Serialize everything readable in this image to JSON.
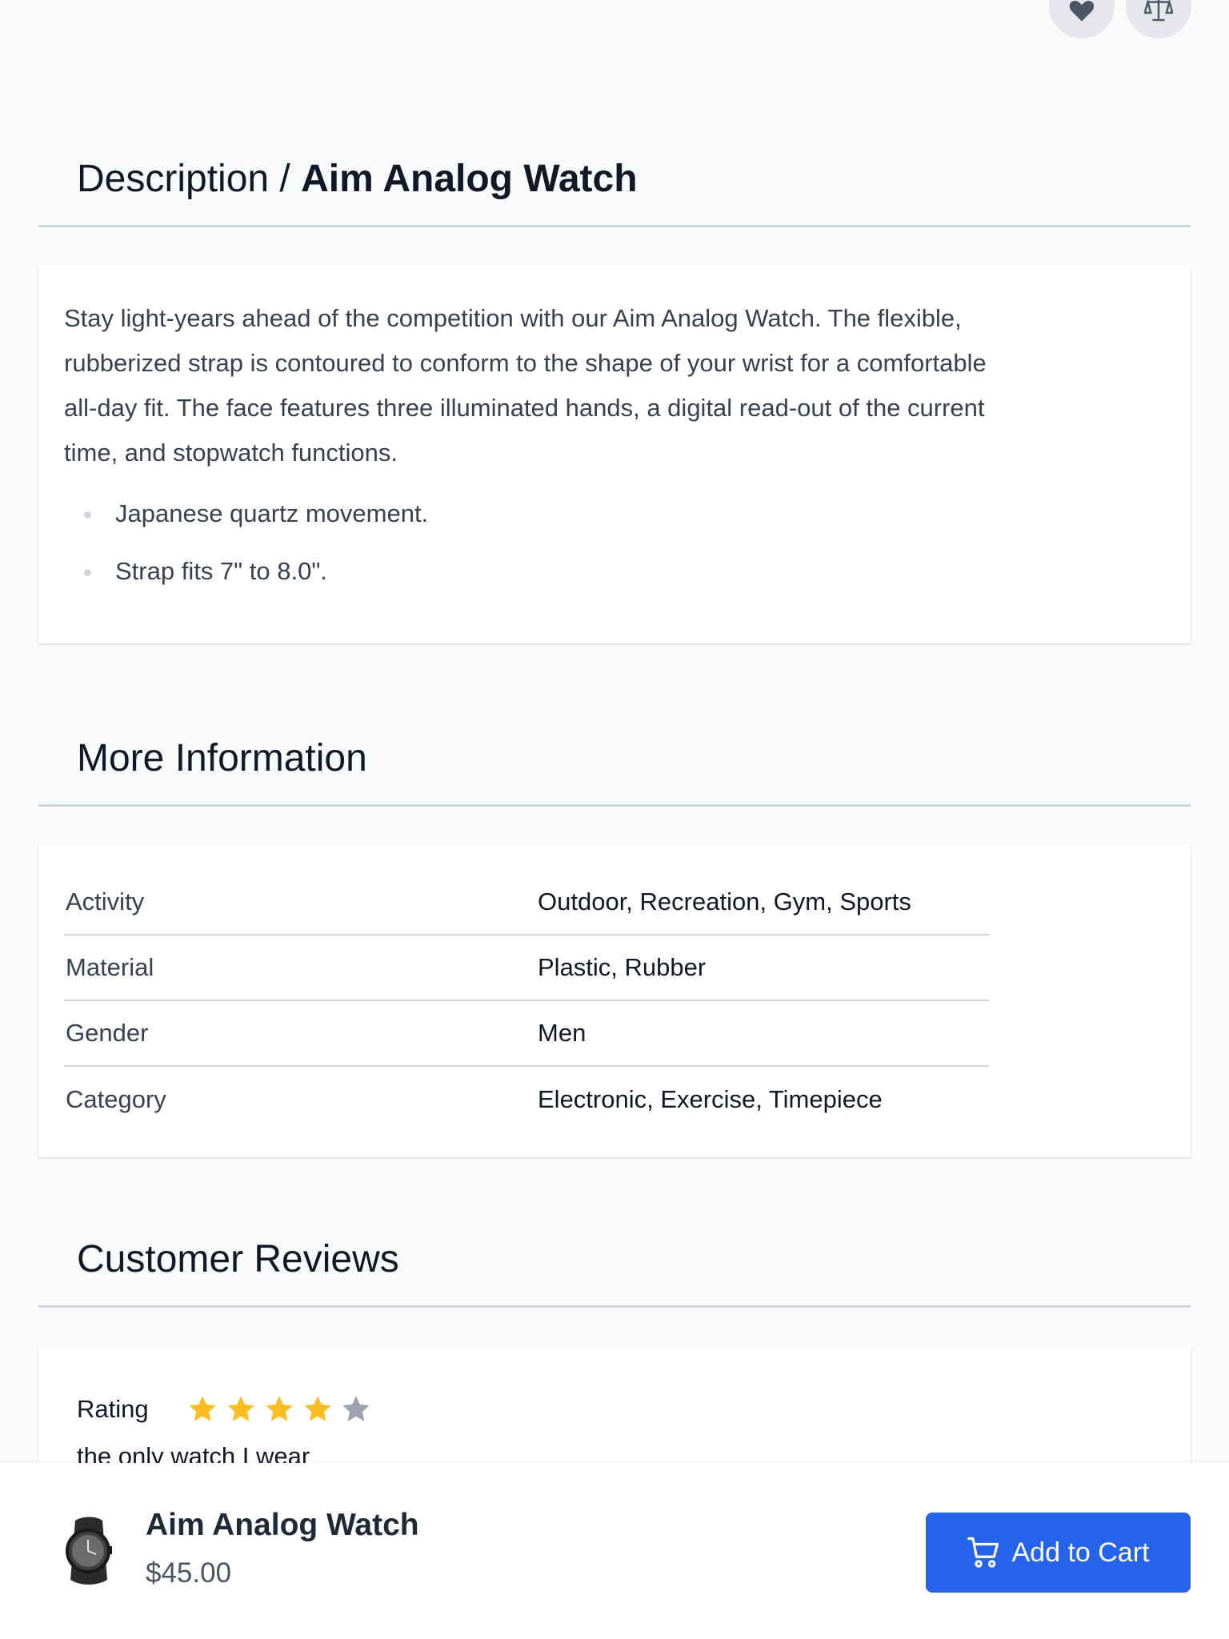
{
  "actions": {
    "wishlist_icon": "heart-icon",
    "compare_icon": "scale-icon"
  },
  "description": {
    "heading_prefix": "Description / ",
    "heading_product": "Aim Analog Watch",
    "text": "Stay light-years ahead of the competition with our Aim Analog Watch. The flexible, rubberized strap is contoured to conform to the shape of your wrist for a comfortable all-day fit. The face features three illuminated hands, a digital read-out of the current time, and stopwatch functions.",
    "bullets": [
      "Japanese quartz movement.",
      "Strap fits 7\" to 8.0\"."
    ]
  },
  "more_info": {
    "heading": "More Information",
    "rows": [
      {
        "key": "Activity",
        "value": "Outdoor, Recreation, Gym, Sports"
      },
      {
        "key": "Material",
        "value": "Plastic, Rubber"
      },
      {
        "key": "Gender",
        "value": "Men"
      },
      {
        "key": "Category",
        "value": "Electronic, Exercise, Timepiece"
      }
    ]
  },
  "reviews": {
    "heading": "Customer Reviews",
    "rating_label": "Rating",
    "rating_value": 4,
    "rating_max": 5,
    "review_title": "the only watch I wear"
  },
  "sticky_bar": {
    "product_name": "Aim Analog Watch",
    "price": "$45.00",
    "add_to_cart_label": "Add to Cart"
  },
  "colors": {
    "primary": "#2563eb",
    "star_filled": "#fbbf24",
    "star_empty": "#9ca3af"
  }
}
